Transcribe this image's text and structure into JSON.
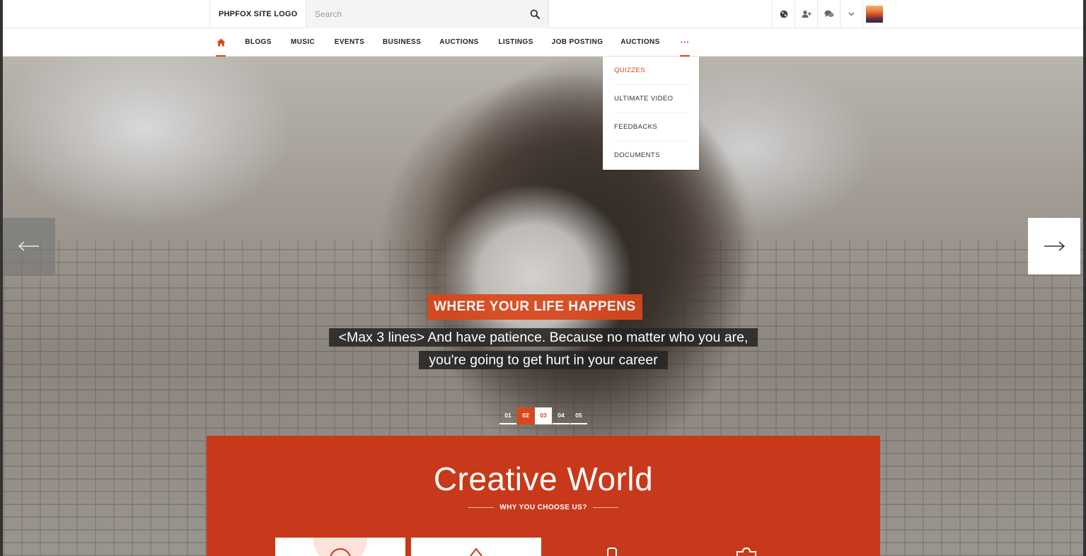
{
  "header": {
    "logo": "PHPFOX SITE LOGO",
    "search_placeholder": "Search",
    "icons": [
      "globe-icon",
      "add-friend-icon",
      "chat-icon",
      "chevron-down-icon"
    ]
  },
  "nav": {
    "items": [
      "BLOGS",
      "MUSIC",
      "EVENTS",
      "BUSINESS",
      "AUCTIONS",
      "LISTINGS",
      "JOB POSTING",
      "AUCTIONS"
    ],
    "more_label": "···"
  },
  "dropdown": {
    "items": [
      "QUIZZES",
      "ULTIMATE VIDEO",
      "FEEDBACKS",
      "DOCUMENTS"
    ]
  },
  "slider": {
    "title": "WHERE YOUR LIFE HAPPENS",
    "text": "<Max 3 lines> And have patience. Because no matter who you are, you're going to get hurt in your career",
    "pages": [
      "01",
      "02",
      "03",
      "04",
      "05"
    ]
  },
  "feature": {
    "title": "Creative World",
    "subtitle": "WHY YOU CHOOSE US?"
  },
  "colors": {
    "accent": "#d9471b",
    "feature_bg": "#c7391a"
  }
}
